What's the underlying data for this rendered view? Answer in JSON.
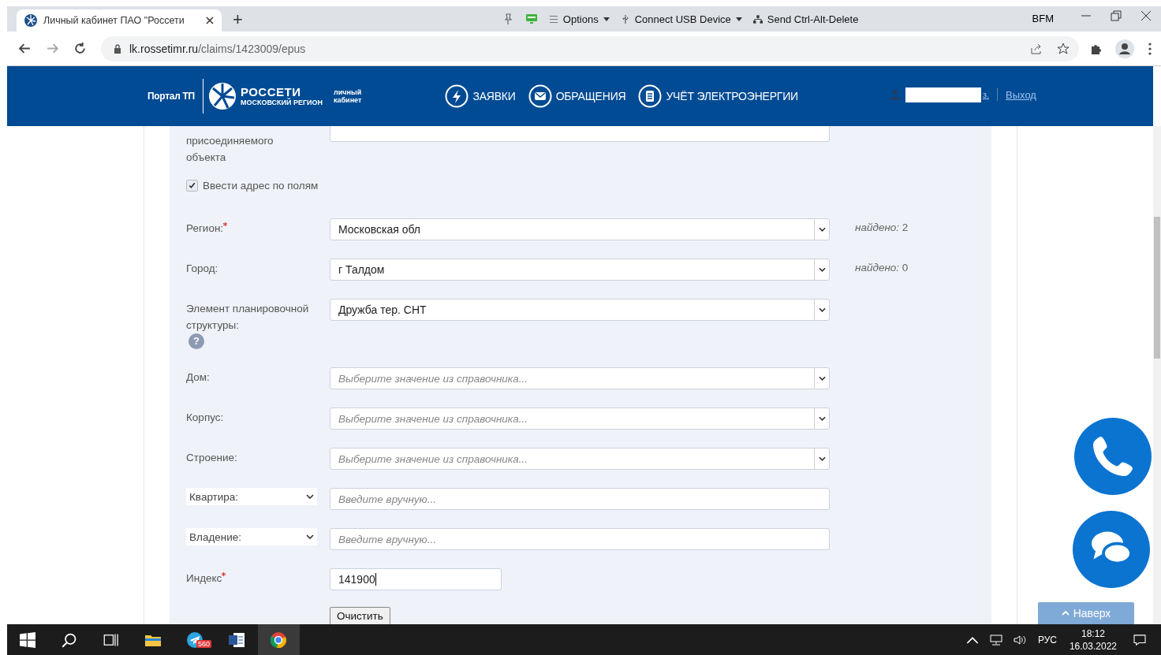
{
  "browser": {
    "tab_title": "Личный кабинет ПАО \"Россети",
    "new_tab": "+",
    "vm_toolbar": {
      "options": "Options",
      "usb": "Connect USB Device",
      "cad": "Send Ctrl-Alt-Delete",
      "user": "BFM"
    },
    "url_host": "lk.rossetimr.ru",
    "url_path": "/claims/1423009/epus"
  },
  "header": {
    "portal": "Портал ТП",
    "logo_title": "РОССЕТИ",
    "logo_subtitle": "МОСКОВСКИЙ РЕГИОН",
    "cabinet": [
      "личный",
      "кабинет"
    ],
    "nav": [
      {
        "label": "ЗАЯВКИ",
        "kind": "bolt"
      },
      {
        "label": "ОБРАЩЕНИЯ",
        "kind": "mail"
      },
      {
        "label": "УЧЁТ ЭЛЕКТРОЭНЕРГИИ",
        "kind": "doc"
      }
    ],
    "user_tail": "з.",
    "logout": "Выход"
  },
  "form": {
    "cut_label": "присоединяемого объекта",
    "address_checkbox": {
      "label": "Ввести адрес по полям",
      "checked": true
    },
    "fields": [
      {
        "kind": "select",
        "label": "Регион:",
        "required": true,
        "value": "Московская обл",
        "found": {
          "note": "найдено:",
          "count": "2"
        }
      },
      {
        "kind": "select",
        "label": "Город:",
        "required": false,
        "value": "г Талдом",
        "found": {
          "note": "найдено:",
          "count": "0"
        }
      },
      {
        "kind": "select",
        "label": "Элемент планировочной структуры:",
        "required": false,
        "help": "?",
        "value": "Дружба тер. СНТ"
      },
      {
        "kind": "select",
        "label": "Дом:",
        "required": false,
        "placeholder": "Выберите значение из справочника..."
      },
      {
        "kind": "select",
        "label": "Корпус:",
        "required": false,
        "placeholder": "Выберите значение из справочника..."
      },
      {
        "kind": "select",
        "label": "Строение:",
        "required": false,
        "placeholder": "Выберите значение из справочника..."
      },
      {
        "kind": "picker",
        "label": "Квартира:",
        "required": false,
        "placeholder": "Введите вручную..."
      },
      {
        "kind": "picker",
        "label": "Владение:",
        "required": false,
        "placeholder": "Введите вручную..."
      },
      {
        "kind": "input",
        "label": "Индекс",
        "required": true,
        "value": "141900"
      }
    ],
    "clear_button": "Очистить"
  },
  "widgets": {
    "top_button": "Наверх"
  },
  "taskbar": {
    "badge": "560",
    "lang": "РУС",
    "time": "18:12",
    "date": "16.03.2022"
  }
}
